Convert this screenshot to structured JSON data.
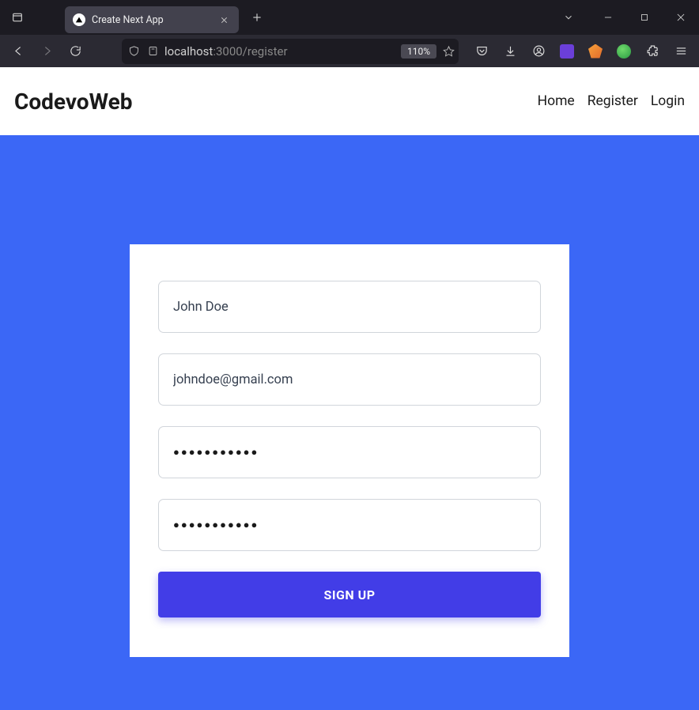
{
  "window": {
    "tab_title": "Create Next App",
    "zoom_badge": "110%"
  },
  "url": {
    "host_prefix": "localhost",
    "host_rest": ":3000/register"
  },
  "site": {
    "brand": "CodevoWeb",
    "nav": {
      "home": "Home",
      "register": "Register",
      "login": "Login"
    }
  },
  "form": {
    "name": "John Doe",
    "email": "johndoe@gmail.com",
    "password": "●●●●●●●●●●●",
    "confirm": "●●●●●●●●●●●",
    "submit": "SIGN UP"
  }
}
